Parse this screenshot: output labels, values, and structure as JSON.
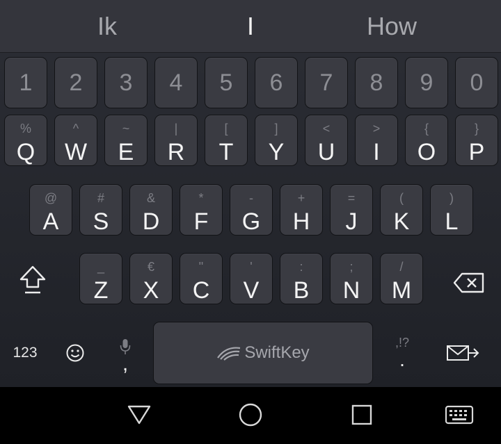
{
  "suggestions": [
    "Ik",
    "I",
    "How"
  ],
  "number_row": [
    "1",
    "2",
    "3",
    "4",
    "5",
    "6",
    "7",
    "8",
    "9",
    "0"
  ],
  "row1": [
    {
      "hint": "%",
      "label": "Q"
    },
    {
      "hint": "^",
      "label": "W"
    },
    {
      "hint": "~",
      "label": "E"
    },
    {
      "hint": "|",
      "label": "R"
    },
    {
      "hint": "[",
      "label": "T"
    },
    {
      "hint": "]",
      "label": "Y"
    },
    {
      "hint": "<",
      "label": "U"
    },
    {
      "hint": ">",
      "label": "I"
    },
    {
      "hint": "{",
      "label": "O"
    },
    {
      "hint": "}",
      "label": "P"
    }
  ],
  "row2": [
    {
      "hint": "@",
      "label": "A"
    },
    {
      "hint": "#",
      "label": "S"
    },
    {
      "hint": "&",
      "label": "D"
    },
    {
      "hint": "*",
      "label": "F"
    },
    {
      "hint": "-",
      "label": "G"
    },
    {
      "hint": "+",
      "label": "H"
    },
    {
      "hint": "=",
      "label": "J"
    },
    {
      "hint": "(",
      "label": "K"
    },
    {
      "hint": ")",
      "label": "L"
    }
  ],
  "row3": [
    {
      "hint": "_",
      "label": "Z"
    },
    {
      "hint": "€",
      "label": "X"
    },
    {
      "hint": "\"",
      "label": "C"
    },
    {
      "hint": "'",
      "label": "V"
    },
    {
      "hint": ":",
      "label": "B"
    },
    {
      "hint": ";",
      "label": "N"
    },
    {
      "hint": "/",
      "label": "M"
    }
  ],
  "bottom_row": {
    "numbers_label": "123",
    "comma_label": ",",
    "period_hint": ",!?",
    "period_label": ".",
    "space_brand": "SwiftKey"
  },
  "icons": {
    "shift": "shift-icon",
    "backspace": "backspace-icon",
    "emoji": "emoji-icon",
    "mic": "microphone-icon",
    "enter": "send-icon",
    "nav_back": "back-triangle-icon",
    "nav_home": "home-circle-icon",
    "nav_recents": "recents-square-icon",
    "nav_keyboard": "keyboard-icon"
  },
  "colors": {
    "key": "#3a3b42",
    "keyboard_bg": "#25272d",
    "suggestion_bar": "#34353c",
    "label": "#f4f4f4",
    "hint": "#7c7d84"
  }
}
